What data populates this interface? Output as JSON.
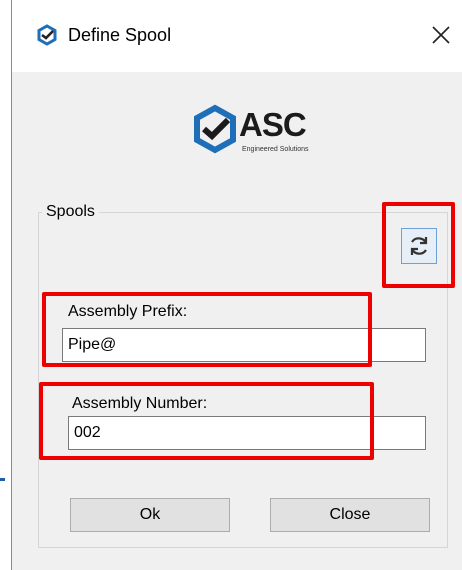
{
  "window": {
    "title": "Define Spool",
    "close_glyph": "✕"
  },
  "logo": {
    "brand": "ASC",
    "subtitle": "Engineered Solutions"
  },
  "group": {
    "label": "Spools"
  },
  "refresh": {
    "icon": "refresh-icon"
  },
  "fields": {
    "prefix_label": "Assembly Prefix:",
    "prefix_value": "Pipe@",
    "number_label": "Assembly Number:",
    "number_value": "002"
  },
  "buttons": {
    "ok": "Ok",
    "close": "Close"
  },
  "colors": {
    "highlight": "#ee0000",
    "brand_blue": "#1e6fb8",
    "dialog_bg": "#f0f0f0"
  }
}
